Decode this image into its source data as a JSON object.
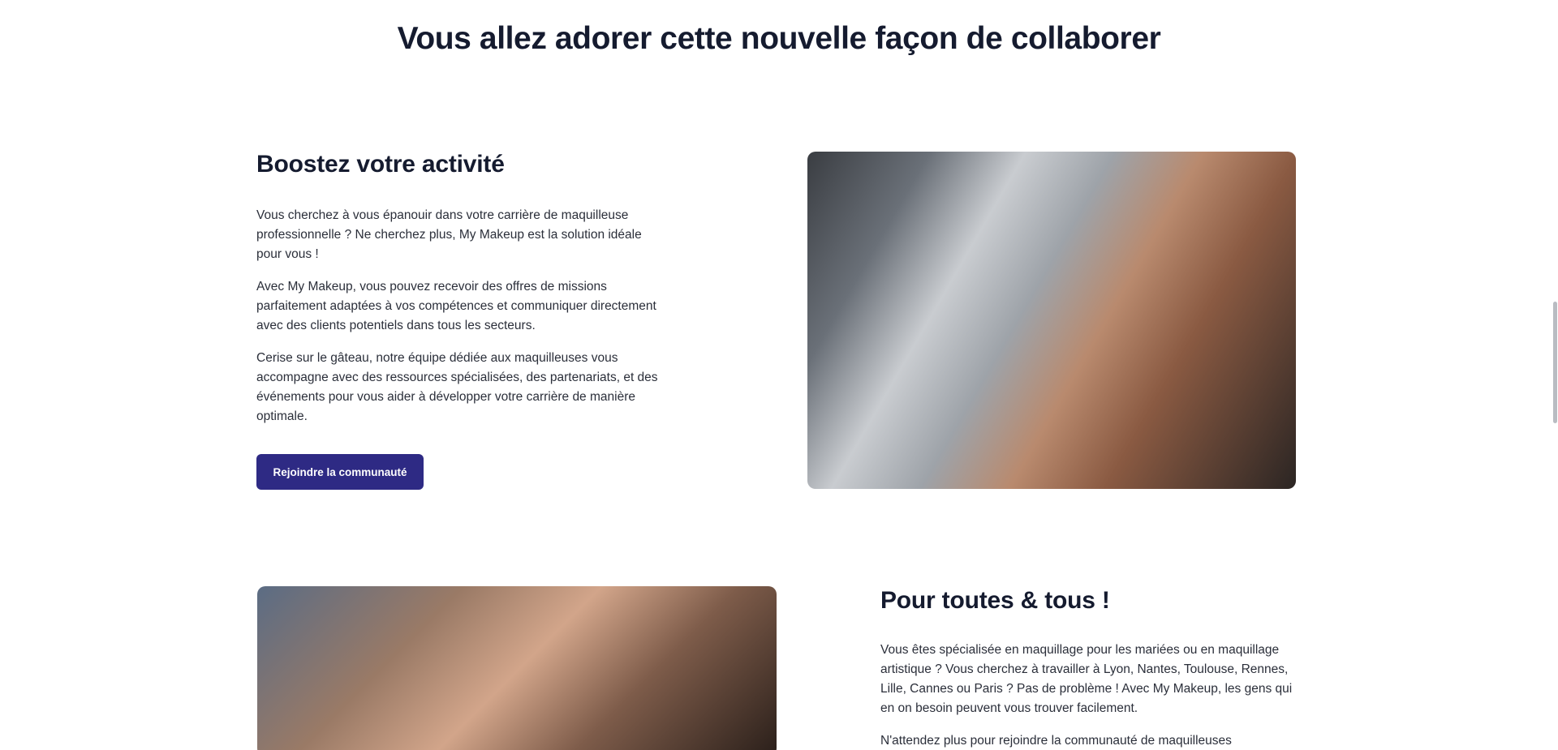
{
  "page": {
    "heading": "Vous allez adorer cette nouvelle façon de collaborer"
  },
  "section_boost": {
    "title": "Boostez votre activité",
    "paragraphs": [
      "Vous cherchez à vous épanouir dans votre carrière de maquilleuse professionnelle ? Ne cherchez plus, My Makeup est la solution idéale pour vous !",
      "Avec My Makeup, vous pouvez recevoir des offres de missions parfaitement adaptées à vos compétences et communiquer directement avec des clients potentiels dans tous les secteurs.",
      "Cerise sur le gâteau, notre équipe dédiée aux maquilleuses vous accompagne avec des ressources spécialisées, des partenariats, et des événements pour vous aider à développer votre carrière de manière optimale."
    ],
    "cta_label": "Rejoindre la communauté"
  },
  "section_everyone": {
    "title": "Pour toutes & tous !",
    "paragraphs": [
      "Vous êtes spécialisée en maquillage pour les mariées ou en maquillage artistique ? Vous cherchez à travailler à Lyon, Nantes, Toulouse, Rennes, Lille, Cannes ou Paris ? Pas de problème ! Avec My Makeup, les gens qui en on besoin peuvent vous trouver facilement.",
      "N'attendez plus pour rejoindre la communauté de maquilleuses"
    ]
  },
  "colors": {
    "accent": "#2e2a84",
    "heading": "#151b2f"
  }
}
